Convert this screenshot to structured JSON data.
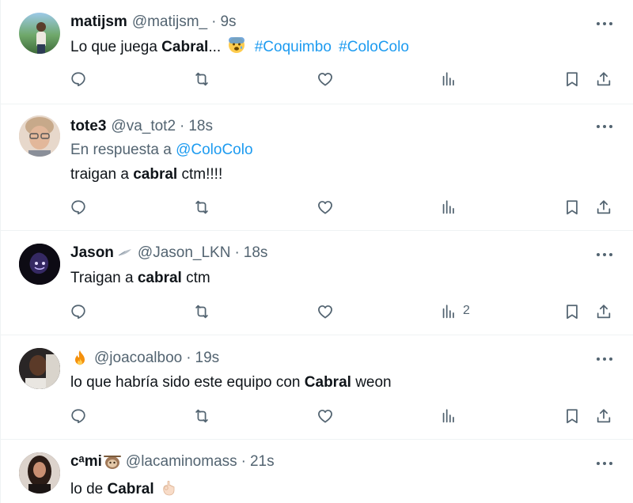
{
  "tweets": [
    {
      "display_name": "matijsm",
      "handle": "@matijsm_",
      "dot": "·",
      "time": "9s",
      "text_pre": "Lo que juega ",
      "text_bold": "Cabral",
      "text_post": "... ",
      "emoji": "anxious-face",
      "hashtags": [
        "#Coquimbo",
        "#ColoColo"
      ],
      "views": ""
    },
    {
      "display_name": "tote3",
      "handle": "@va_tot2",
      "dot": "·",
      "time": "18s",
      "reply_prefix": "En respuesta a ",
      "reply_handle": "@ColoColo",
      "text_pre": "traigan a ",
      "text_bold": "cabral",
      "text_post": " ctm!!!!",
      "views": ""
    },
    {
      "display_name": "Jason",
      "handle": "@Jason_LKN",
      "dot": "·",
      "time": "18s",
      "text_pre": "Traigan a ",
      "text_bold": "cabral",
      "text_post": " ctm",
      "views": "2"
    },
    {
      "display_name": "",
      "handle": "@joacoalboo",
      "dot": "·",
      "time": "19s",
      "text_pre": "lo que habría sido este equipo con ",
      "text_bold": "Cabral",
      "text_post": " weon",
      "views": ""
    },
    {
      "display_name": "cᵃmi",
      "handle": "@lacaminomass",
      "dot": "·",
      "time": "21s",
      "text_pre": "lo de ",
      "text_bold": "Cabral",
      "text_post": " ",
      "views": ""
    }
  ],
  "icons": {
    "reply": "reply-icon",
    "retweet": "retweet-icon",
    "like": "like-icon",
    "views": "views-icon",
    "bookmark": "bookmark-icon",
    "share": "share-icon",
    "more": "more-icon"
  },
  "colors": {
    "link": "#1d9bf0",
    "muted": "#536471",
    "text": "#0f1419",
    "divider": "#eff3f4"
  }
}
